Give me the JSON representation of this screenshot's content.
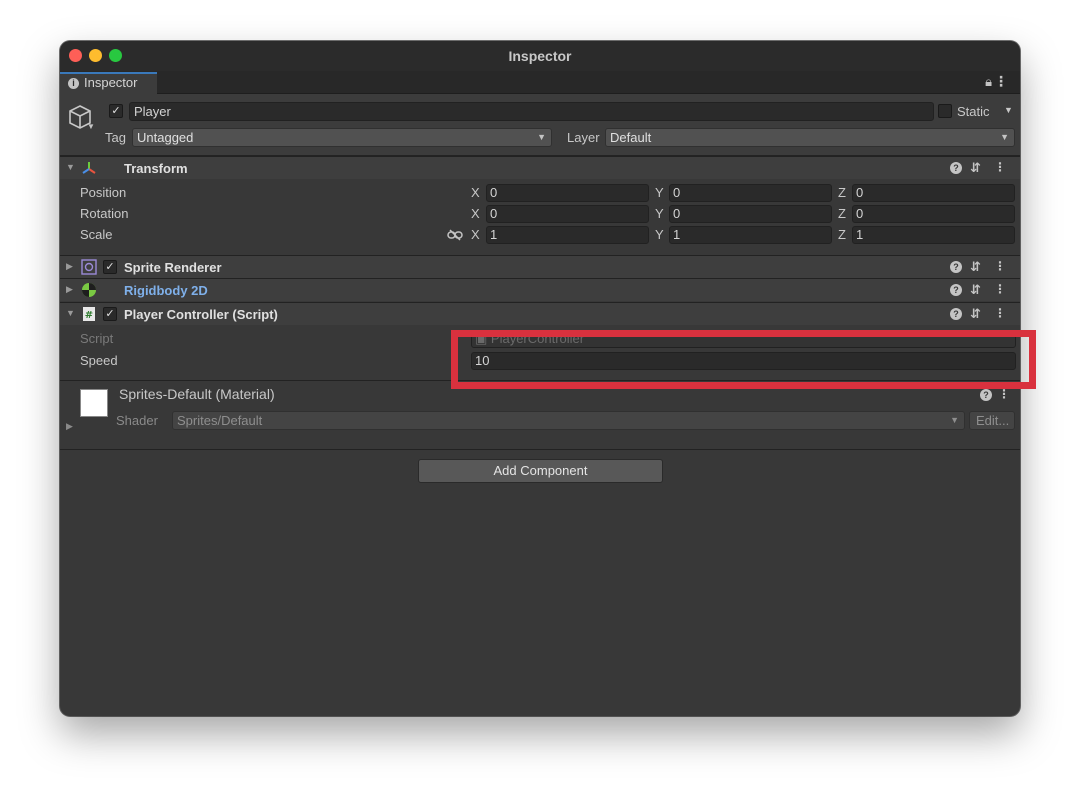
{
  "window": {
    "title": "Inspector"
  },
  "tab": {
    "label": "Inspector",
    "icons": [
      "info-icon",
      "lock-icon",
      "kebab-menu-icon"
    ]
  },
  "gameobject": {
    "active": true,
    "name": "Player",
    "static_label": "Static",
    "static_checked": false,
    "tag_label": "Tag",
    "tag_value": "Untagged",
    "layer_label": "Layer",
    "layer_value": "Default"
  },
  "transform": {
    "name": "Transform",
    "rows": [
      {
        "label": "Position",
        "x": "0",
        "y": "0",
        "z": "0"
      },
      {
        "label": "Rotation",
        "x": "0",
        "y": "0",
        "z": "0"
      },
      {
        "label": "Scale",
        "x": "1",
        "y": "1",
        "z": "1"
      }
    ],
    "axis": {
      "x": "X",
      "y": "Y",
      "z": "Z"
    }
  },
  "sprite_renderer": {
    "name": "Sprite Renderer",
    "enabled": true
  },
  "rigidbody": {
    "name": "Rigidbody 2D"
  },
  "player_controller": {
    "name": "Player Controller (Script)",
    "enabled": true,
    "script_label": "Script",
    "script_value": "PlayerController",
    "speed_label": "Speed",
    "speed_value": "10"
  },
  "material": {
    "name": "Sprites-Default (Material)",
    "shader_label": "Shader",
    "shader_value": "Sprites/Default",
    "edit_label": "Edit..."
  },
  "add_component_label": "Add Component",
  "highlight_color": "#d9313e",
  "accent": "#3a79bb"
}
